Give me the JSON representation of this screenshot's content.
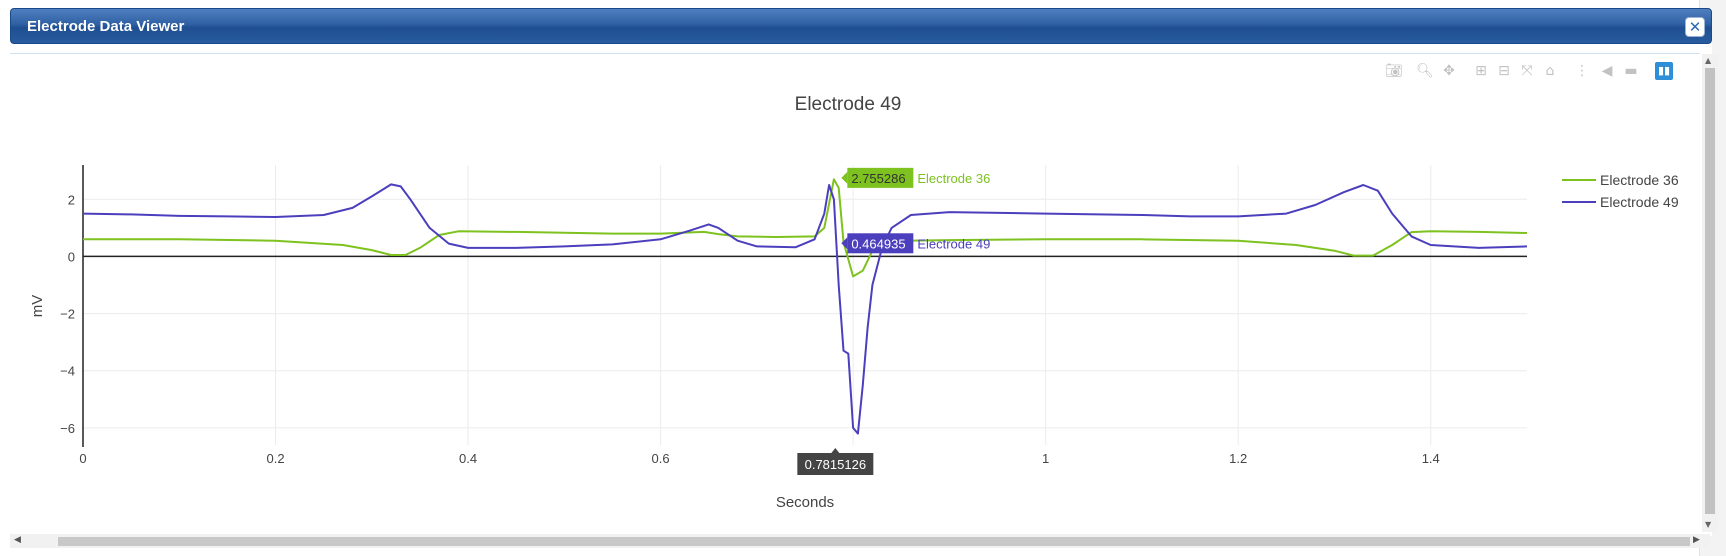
{
  "window": {
    "title": "Electrode Data Viewer",
    "close_icon": "close-icon"
  },
  "toolbar": {
    "icons": [
      "camera-icon",
      "zoom-icon",
      "pan-icon",
      "zoom-in-icon",
      "zoom-out-icon",
      "autoscale-icon",
      "home-icon",
      "spike-lines-icon",
      "hover-closest-icon",
      "hover-compare-icon",
      "plotly-logo-icon"
    ]
  },
  "chart_data": {
    "type": "line",
    "title": "Electrode 49",
    "xlabel": "Seconds",
    "ylabel": "mV",
    "xlim": [
      0,
      1.5
    ],
    "ylim": [
      -6.6,
      3.2
    ],
    "xticks": [
      0,
      0.2,
      0.4,
      0.6,
      0.8,
      1,
      1.2,
      1.4
    ],
    "xtick_labels": [
      "0",
      "0.2",
      "0.4",
      "0.6",
      "",
      "1",
      "1.2",
      "1.4"
    ],
    "yticks": [
      2,
      0,
      -2,
      -4,
      -6
    ],
    "ytick_labels": [
      "2",
      "0",
      "−2",
      "−4",
      "−6"
    ],
    "grid": true,
    "legend_position": "top-right",
    "series": [
      {
        "name": "Electrode 36",
        "color": "#7dc21e",
        "points": [
          [
            0,
            0.6
          ],
          [
            0.1,
            0.6
          ],
          [
            0.2,
            0.55
          ],
          [
            0.27,
            0.4
          ],
          [
            0.3,
            0.22
          ],
          [
            0.32,
            0.05
          ],
          [
            0.335,
            0.05
          ],
          [
            0.35,
            0.3
          ],
          [
            0.37,
            0.75
          ],
          [
            0.39,
            0.88
          ],
          [
            0.45,
            0.86
          ],
          [
            0.5,
            0.83
          ],
          [
            0.55,
            0.8
          ],
          [
            0.6,
            0.8
          ],
          [
            0.645,
            0.86
          ],
          [
            0.66,
            0.78
          ],
          [
            0.68,
            0.7
          ],
          [
            0.72,
            0.68
          ],
          [
            0.76,
            0.7
          ],
          [
            0.77,
            1.0
          ],
          [
            0.78,
            2.7
          ],
          [
            0.785,
            2.4
          ],
          [
            0.79,
            0.5
          ],
          [
            0.8,
            -0.7
          ],
          [
            0.81,
            -0.5
          ],
          [
            0.82,
            0.2
          ],
          [
            0.83,
            0.5
          ],
          [
            0.85,
            0.55
          ],
          [
            0.9,
            0.57
          ],
          [
            1.0,
            0.6
          ],
          [
            1.1,
            0.6
          ],
          [
            1.2,
            0.55
          ],
          [
            1.26,
            0.4
          ],
          [
            1.3,
            0.2
          ],
          [
            1.32,
            0.03
          ],
          [
            1.34,
            0.03
          ],
          [
            1.36,
            0.4
          ],
          [
            1.38,
            0.85
          ],
          [
            1.4,
            0.88
          ],
          [
            1.45,
            0.86
          ],
          [
            1.5,
            0.82
          ]
        ]
      },
      {
        "name": "Electrode 49",
        "color": "#4b3fbd",
        "points": [
          [
            0,
            1.5
          ],
          [
            0.05,
            1.47
          ],
          [
            0.1,
            1.42
          ],
          [
            0.15,
            1.4
          ],
          [
            0.2,
            1.38
          ],
          [
            0.25,
            1.45
          ],
          [
            0.28,
            1.7
          ],
          [
            0.3,
            2.1
          ],
          [
            0.32,
            2.52
          ],
          [
            0.33,
            2.45
          ],
          [
            0.34,
            2.0
          ],
          [
            0.36,
            1.0
          ],
          [
            0.38,
            0.45
          ],
          [
            0.4,
            0.3
          ],
          [
            0.45,
            0.3
          ],
          [
            0.5,
            0.35
          ],
          [
            0.55,
            0.42
          ],
          [
            0.6,
            0.6
          ],
          [
            0.63,
            0.9
          ],
          [
            0.65,
            1.12
          ],
          [
            0.66,
            1.0
          ],
          [
            0.68,
            0.55
          ],
          [
            0.7,
            0.35
          ],
          [
            0.74,
            0.32
          ],
          [
            0.76,
            0.6
          ],
          [
            0.77,
            1.5
          ],
          [
            0.775,
            2.5
          ],
          [
            0.78,
            2.0
          ],
          [
            0.785,
            -1.0
          ],
          [
            0.79,
            -3.3
          ],
          [
            0.795,
            -3.4
          ],
          [
            0.8,
            -6.0
          ],
          [
            0.805,
            -6.2
          ],
          [
            0.81,
            -4.5
          ],
          [
            0.815,
            -2.5
          ],
          [
            0.82,
            -1.0
          ],
          [
            0.83,
            0.3
          ],
          [
            0.84,
            1.0
          ],
          [
            0.86,
            1.45
          ],
          [
            0.9,
            1.55
          ],
          [
            1.0,
            1.5
          ],
          [
            1.1,
            1.45
          ],
          [
            1.15,
            1.4
          ],
          [
            1.2,
            1.4
          ],
          [
            1.25,
            1.5
          ],
          [
            1.28,
            1.8
          ],
          [
            1.31,
            2.25
          ],
          [
            1.33,
            2.5
          ],
          [
            1.345,
            2.3
          ],
          [
            1.36,
            1.5
          ],
          [
            1.38,
            0.7
          ],
          [
            1.4,
            0.4
          ],
          [
            1.45,
            0.3
          ],
          [
            1.5,
            0.35
          ]
        ]
      }
    ],
    "hover": {
      "x_label": "0.7815126",
      "series_labels": [
        {
          "value": "2.755286",
          "name": "Electrode 36",
          "bg": "#7dc21e",
          "text_color": "#333333",
          "y": 2.75
        },
        {
          "value": "0.464935",
          "name": "Electrode 49",
          "bg": "#4b3fbd",
          "text_color": "#ffffff",
          "y": 0.46
        }
      ]
    }
  }
}
